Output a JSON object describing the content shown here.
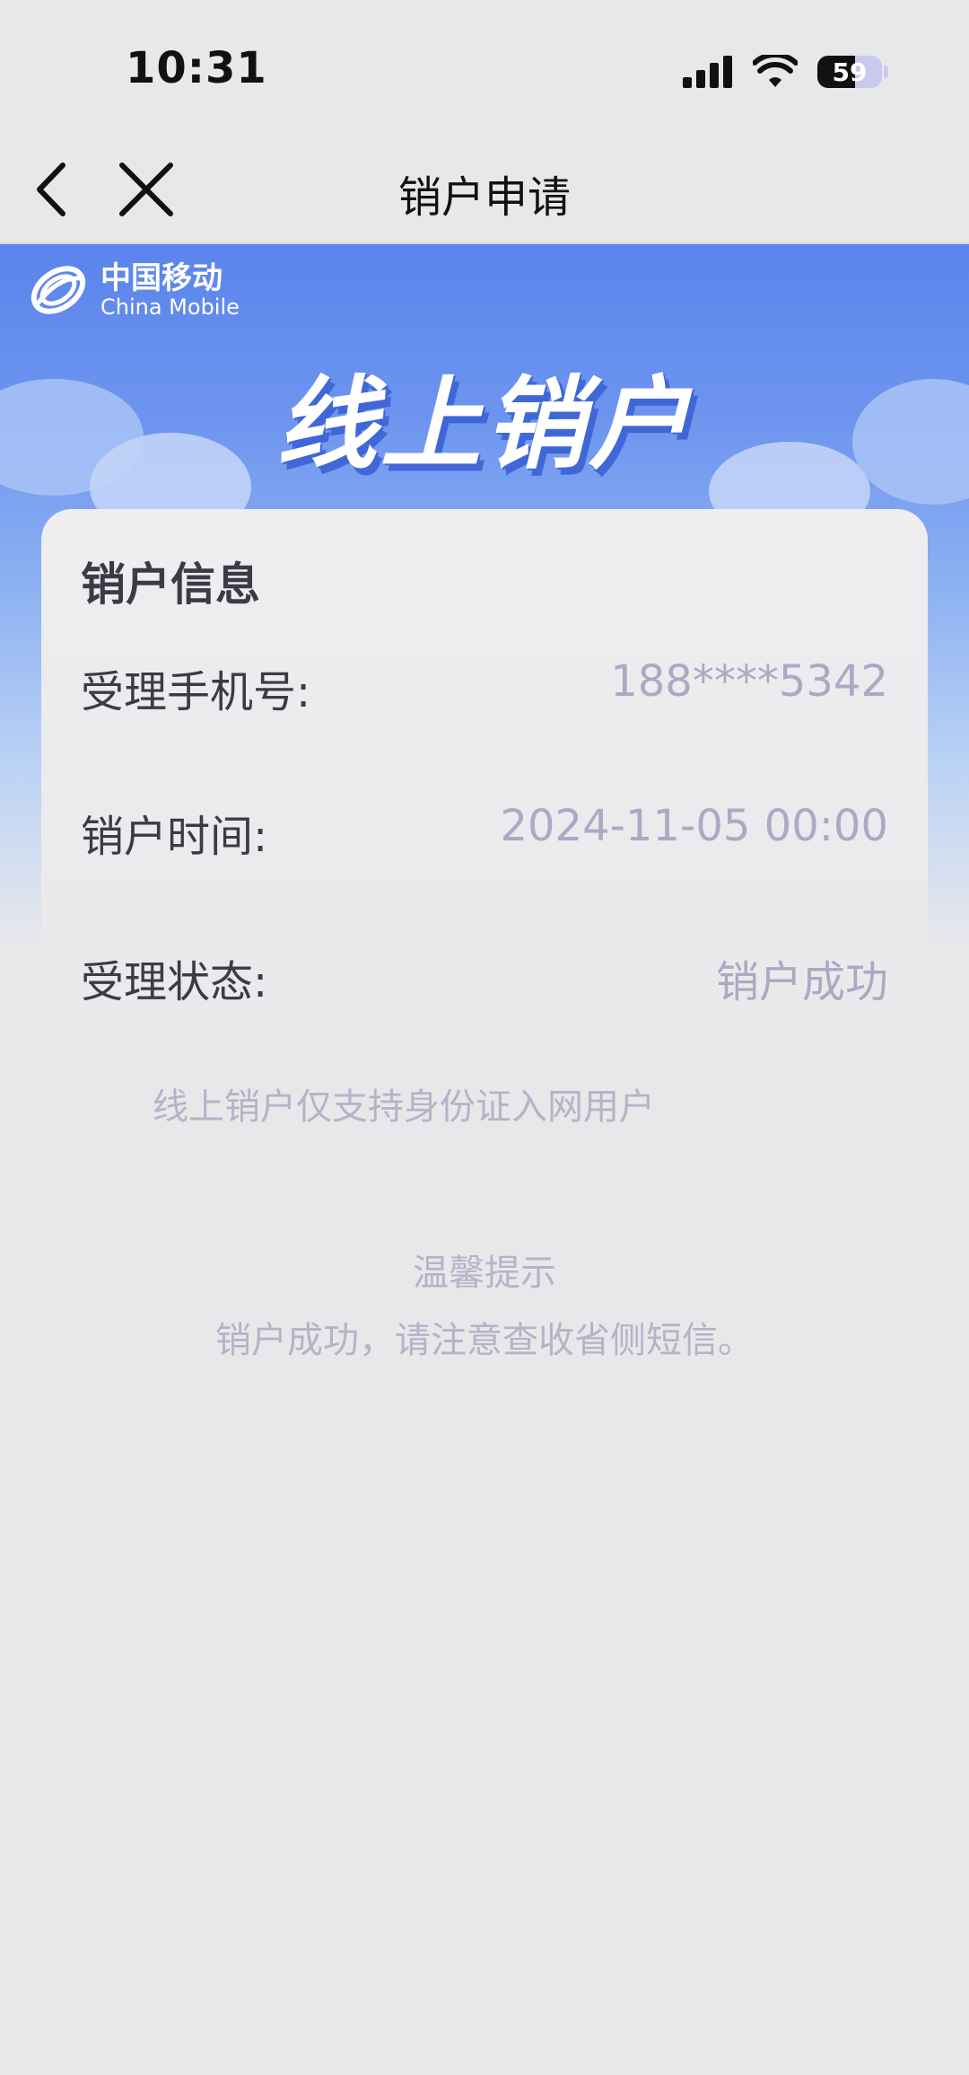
{
  "status_bar": {
    "time": "10:31",
    "battery": "59"
  },
  "nav": {
    "title": "销户申请"
  },
  "banner": {
    "logo_cn": "中国移动",
    "logo_en": "China Mobile",
    "title": "线上销户"
  },
  "card": {
    "title": "销户信息",
    "rows": [
      {
        "label": "受理手机号:",
        "value": "188****5342"
      },
      {
        "label": "销户时间:",
        "value": "2024-11-05 00:00"
      },
      {
        "label": "受理状态:",
        "value": "销户成功"
      }
    ]
  },
  "notice": "线上销户仅支持身份证入网用户",
  "tip": {
    "title": "温馨提示",
    "text": "销户成功，请注意查收省侧短信。"
  },
  "colors": {
    "brand_blue": "#5b84ec",
    "muted_text": "#aaaac4",
    "dark_text": "#3b3b48"
  }
}
